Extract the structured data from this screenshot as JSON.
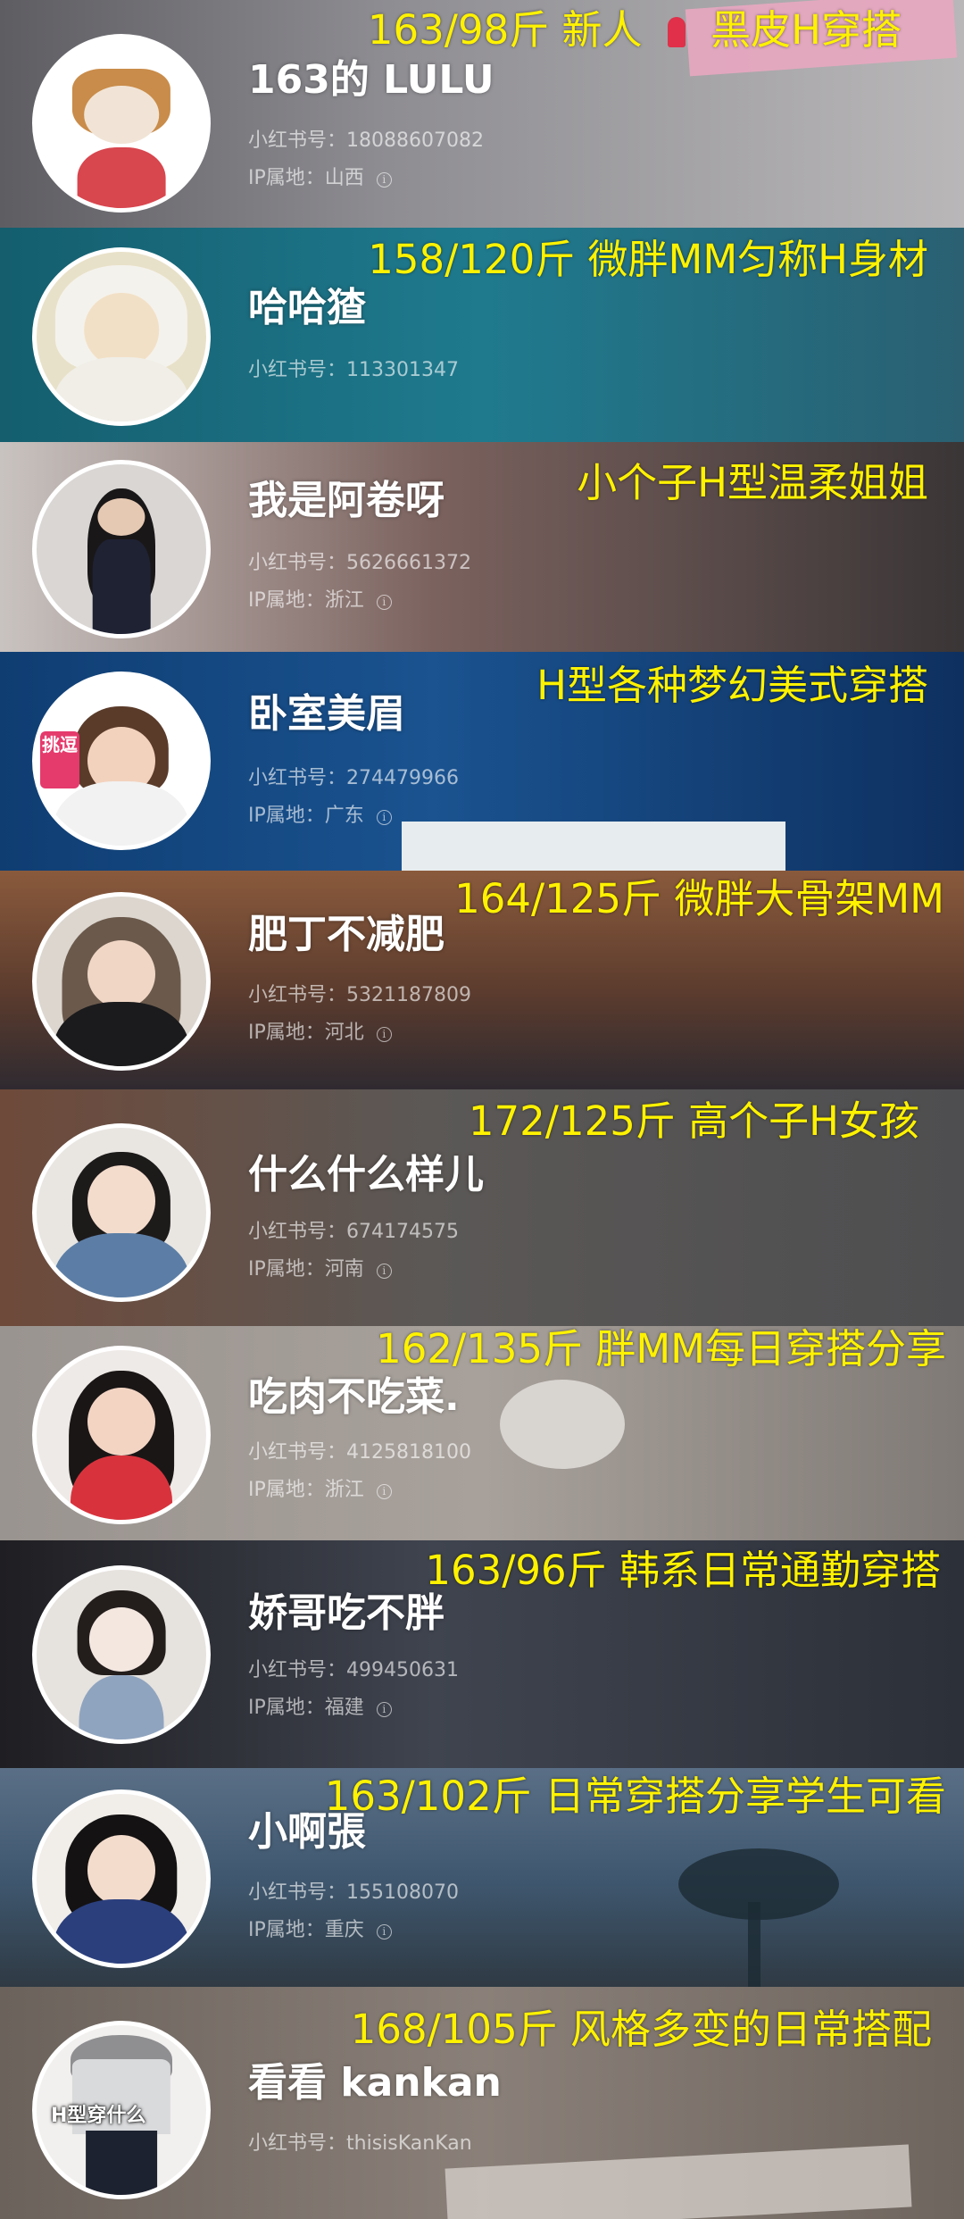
{
  "cards": [
    {
      "tagline": "163/98斤 新人",
      "tagline_suffix": "黑皮H穿搭",
      "name": "163的 LULU",
      "id_label": "小红书号：",
      "id_value": "18088607082",
      "ip_label": "IP属地：",
      "ip_value": "山西",
      "bg": "#8a8a92"
    },
    {
      "tagline": "158/120斤 微胖MM匀称H身材",
      "name": "哈哈猹",
      "id_label": "小红书号：",
      "id_value": "113301347",
      "bg": "#1f6f80"
    },
    {
      "tagline": "小个子H型温柔姐姐",
      "name": "我是阿卷呀",
      "id_label": "小红书号：",
      "id_value": "5626661372",
      "ip_label": "IP属地：",
      "ip_value": "浙江",
      "bg": "#6a5a58"
    },
    {
      "tagline": "H型各种梦幻美式穿搭",
      "name": "卧室美眉",
      "id_label": "小红书号：",
      "id_value": "274479966",
      "ip_label": "IP属地：",
      "ip_value": "广东",
      "bg": "#1c4f87",
      "avatar_badge": "挑逗"
    },
    {
      "tagline": "164/125斤 微胖大骨架MM",
      "name": "肥丁不减肥",
      "id_label": "小红书号：",
      "id_value": "5321187809",
      "ip_label": "IP属地：",
      "ip_value": "河北",
      "bg": "#6b4636"
    },
    {
      "tagline": "172/125斤 高个子H女孩",
      "name": "什么什么样儿",
      "id_label": "小红书号：",
      "id_value": "674174575",
      "ip_label": "IP属地：",
      "ip_value": "河南",
      "bg": "#5c5a58"
    },
    {
      "tagline": "162/135斤 胖MM每日穿搭分享",
      "name": "吃肉不吃菜.",
      "id_label": "小红书号：",
      "id_value": "4125818100",
      "ip_label": "IP属地：",
      "ip_value": "浙江",
      "bg": "#8d8782"
    },
    {
      "tagline": "163/96斤 韩系日常通勤穿搭",
      "name": "娇哥吃不胖",
      "id_label": "小红书号：",
      "id_value": "499450631",
      "ip_label": "IP属地：",
      "ip_value": "福建",
      "bg": "#3a3f4a"
    },
    {
      "tagline": "163/102斤 日常穿搭分享学生可看",
      "name": "小啊張",
      "id_label": "小红书号：",
      "id_value": "155108070",
      "ip_label": "IP属地：",
      "ip_value": "重庆",
      "bg": "#3f5f78"
    },
    {
      "tagline": "168/105斤 风格多变的日常搭配",
      "name": "看看 kankan",
      "id_label": "小红书号：",
      "id_value": "thisisKanKan",
      "bg": "#7d746c",
      "avatar_badge": "H型穿什么"
    }
  ],
  "icons": {
    "info": "ⓘ",
    "pin": "pin-icon"
  },
  "colors": {
    "tagline": "#fff200",
    "name": "#ffffff"
  }
}
